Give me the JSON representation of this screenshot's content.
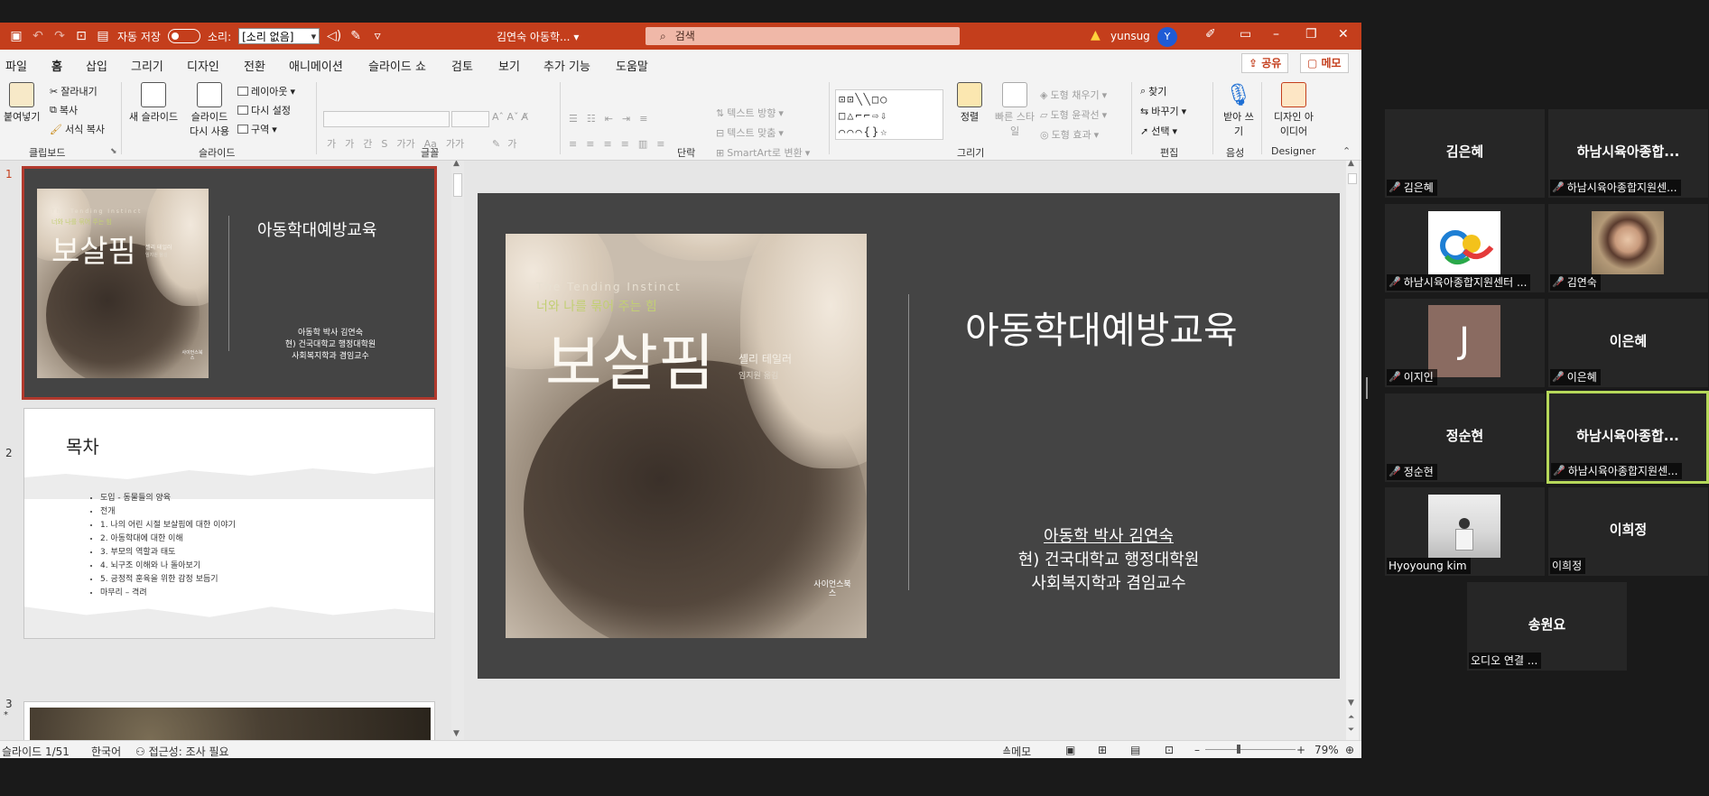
{
  "titlebar": {
    "autosave_label": "자동 저장",
    "sound_label": "소리:",
    "sound_value": "[소리 없음]",
    "doc_title": "김연숙 아동학... ▾",
    "search_placeholder": "검색",
    "user_name": "yunsug",
    "avatar_initial": "Y"
  },
  "tabs": [
    "파일",
    "홈",
    "삽입",
    "그리기",
    "디자인",
    "전환",
    "애니메이션",
    "슬라이드 쇼",
    "검토",
    "보기",
    "추가 기능",
    "도움말"
  ],
  "share_label": "공유",
  "memo_label": "메모",
  "ribbon": {
    "clipboard": {
      "paste": "붙여넣기",
      "cut": "잘라내기",
      "copy": "복사",
      "format_painter": "서식 복사",
      "group": "클립보드"
    },
    "slides": {
      "new_slide": "새 슬라이드",
      "reuse_slide": "슬라이드 다시 사용",
      "layout": "레이아웃",
      "reset": "다시 설정",
      "section": "구역",
      "group": "슬라이드"
    },
    "font": {
      "group": "글꼴"
    },
    "paragraph": {
      "text_direction": "텍스트 방향",
      "align_text": "텍스트 맞춤",
      "smartart": "SmartArt로 변환",
      "group": "단락"
    },
    "drawing": {
      "arrange": "정렬",
      "quick_styles": "빠른 스타일",
      "shape_fill": "도형 채우기",
      "shape_outline": "도형 윤곽선",
      "shape_effects": "도형 효과",
      "group": "그리기"
    },
    "editing": {
      "find": "찾기",
      "replace": "바꾸기",
      "select": "선택",
      "group": "편집"
    },
    "voice": {
      "dictate": "받아 쓰기",
      "group": "음성"
    },
    "designer": {
      "ideas": "디자인 아이디어",
      "group": "Designer"
    }
  },
  "slide1": {
    "title": "아동학대예방교육",
    "info": [
      "아동학 박사 김연숙",
      "현) 건국대학교 행정대학원",
      "사회복지학과 겸임교수"
    ],
    "cover": {
      "en": "The Tending Instinct",
      "subtitle": "너와 나를 묶어 주는 힘",
      "title": "보살핌",
      "author": "셸리 테일러",
      "translator": "임지원 옮김",
      "publisher": "사이언스북스"
    }
  },
  "slide2": {
    "title": "목차",
    "items": [
      "도입 - 동물들의 양육",
      "전개",
      "1. 나의 어린 시절 보살핌에 대한 이야기",
      "2. 아동학대에 대한 이해",
      "3. 부모의 역할과 태도",
      "4. 뇌구조 이해와 나 돌아보기",
      "5. 긍정적 훈육을 위한 감정 보듬기",
      "마무리 – 격려"
    ]
  },
  "thumb_numbers": [
    "1",
    "2",
    "3"
  ],
  "statusbar": {
    "slide_counter": "슬라이드 1/51",
    "language": "한국어",
    "accessibility": "접근성: 조사 필요",
    "notes": "메모",
    "zoom": "79%"
  },
  "zoom": {
    "participants": [
      {
        "name": "김은혜",
        "label": "김은혜"
      },
      {
        "name": "하남시육아종합...",
        "label": "하남시육아종합지원센..."
      },
      {
        "name": "",
        "label": "하남시육아종합지원센터 ..."
      },
      {
        "name": "",
        "label": "김연숙"
      },
      {
        "name": "",
        "label": "이지인",
        "initial": "J"
      },
      {
        "name": "이은혜",
        "label": "이은혜"
      },
      {
        "name": "정순현",
        "label": "정순현"
      },
      {
        "name": "하남시육아종합...",
        "label": "하남시육아종합지원센..."
      },
      {
        "name": "",
        "label": "Hyoyoung kim"
      },
      {
        "name": "이희정",
        "label": "이희정"
      },
      {
        "name": "송원요",
        "label": "오디오 연결 ..."
      }
    ]
  },
  "colors": {
    "ppt_accent": "#c43e1c",
    "slide_bg": "#444444",
    "zoom_bg": "#1a1a1a",
    "speaker_border": "#b6d85a"
  }
}
